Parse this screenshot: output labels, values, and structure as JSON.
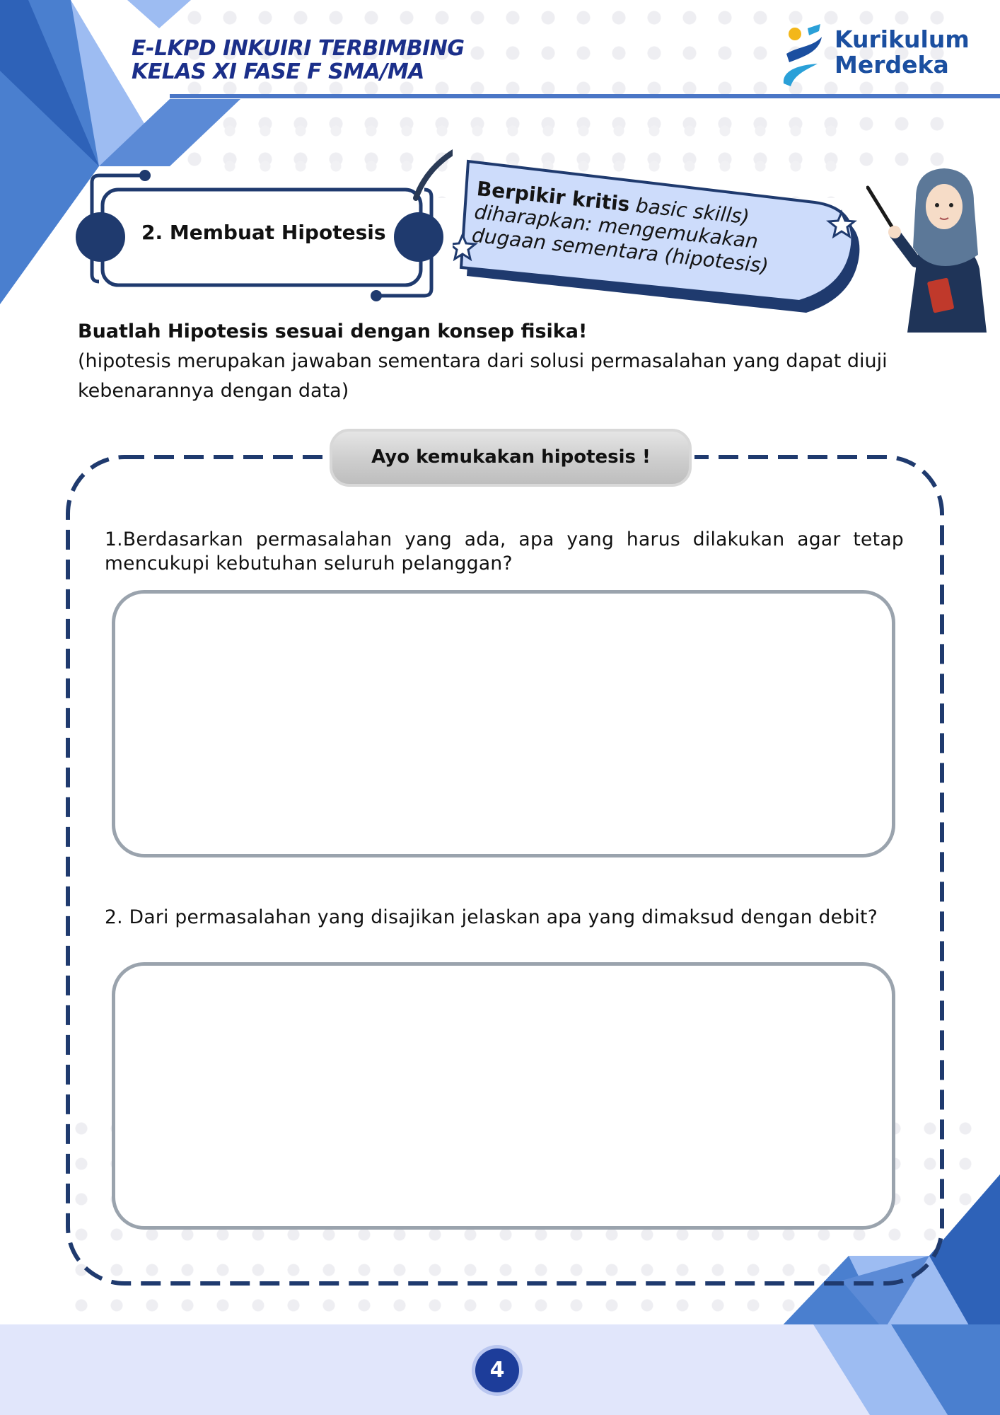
{
  "header": {
    "title_line1": "E-LKPD INKUIRI TERBIMBING",
    "title_line2": "KELAS XI FASE F SMA/MA",
    "logo_line1": "Kurikulum",
    "logo_line2": "Merdeka"
  },
  "section": {
    "label": "2. Membuat Hipotesis"
  },
  "callout": {
    "bold": "Berpikir kritis",
    "italic1": "basic skills)",
    "line2": "diharapkan: mengemukakan",
    "line3": "dugaan sementara (hipotesis)"
  },
  "instruction": {
    "heading": "Buatlah Hipotesis sesuai dengan konsep fisika!",
    "note": "(hipotesis merupakan jawaban sementara dari solusi permasalahan yang dapat diuji kebenarannya dengan data)"
  },
  "activity": {
    "title": "Ayo kemukakan hipotesis !",
    "questions": [
      {
        "text": "1.Berdasarkan permasalahan yang ada, apa yang harus dilakukan agar tetap mencukupi kebutuhan seluruh pelanggan?"
      },
      {
        "text": "2. Dari permasalahan yang disajikan jelaskan apa yang dimaksud dengan debit?"
      }
    ]
  },
  "footer": {
    "page_number": "4"
  },
  "colors": {
    "primary_navy": "#1f3a6e",
    "header_blue": "#1b2f8a",
    "light_blue": "#9dbcf2",
    "mid_blue": "#4a7fcf",
    "callout_fill": "#cddcfb",
    "footer_band": "#e1e6fb"
  }
}
